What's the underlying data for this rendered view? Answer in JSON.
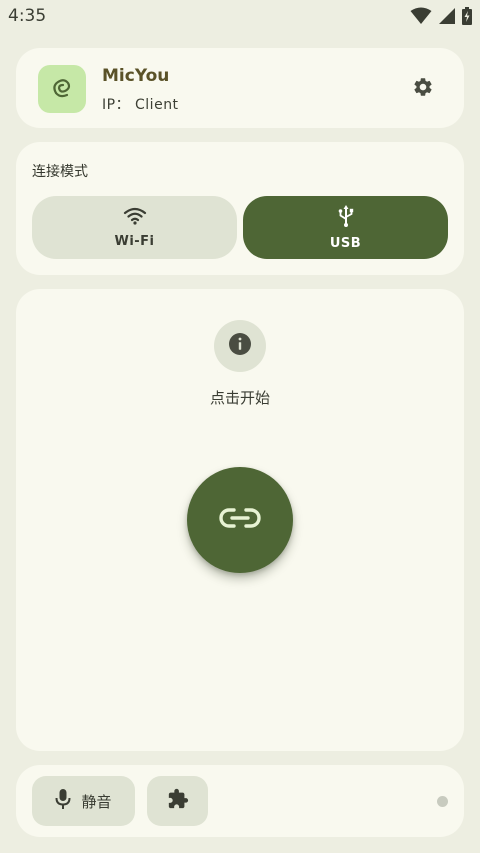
{
  "status_bar": {
    "time": "4:35",
    "icons": [
      "wifi-icon",
      "signal-icon",
      "battery-charging-icon"
    ]
  },
  "header": {
    "app_name": "MicYou",
    "ip_text": "IP： Client",
    "logo_icon": "micyou-logo-icon",
    "settings_icon": "gear-icon"
  },
  "connection_mode": {
    "title": "连接模式",
    "options": [
      {
        "label": "Wi-Fi",
        "icon": "wifi-icon",
        "selected": false
      },
      {
        "label": "USB",
        "icon": "usb-icon",
        "selected": true
      }
    ]
  },
  "main": {
    "info_icon": "info-icon",
    "hint": "点击开始",
    "connect_icon": "link-icon"
  },
  "bottom_bar": {
    "mute_label": "静音",
    "mute_icon": "microphone-icon",
    "plugin_icon": "puzzle-icon",
    "status_indicator": "idle"
  },
  "colors": {
    "background": "#edeee1",
    "card": "#f9f9ef",
    "primary": "#4e6635",
    "secondary_container": "#dfe3d3",
    "logo_bg": "#c6e8a7",
    "title": "#5a5228",
    "indicator": "#c8cbbf"
  }
}
